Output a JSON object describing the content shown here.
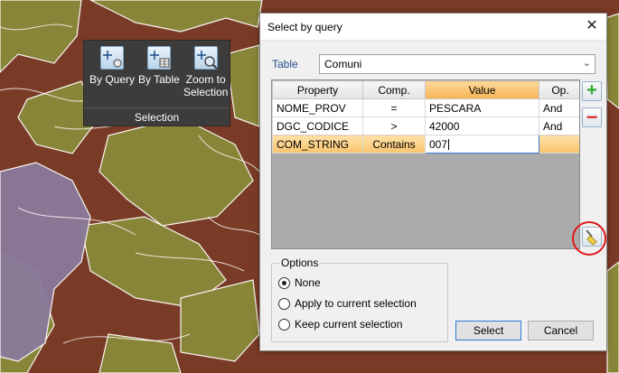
{
  "ribbon": {
    "buttons": [
      {
        "label": "By Query",
        "icon": "select-query-icon"
      },
      {
        "label": "By Table",
        "icon": "select-table-icon"
      },
      {
        "label_line1": "Zoom to",
        "label_line2": "Selection",
        "icon": "zoom-selection-icon"
      }
    ],
    "group_label": "Selection"
  },
  "dialog": {
    "title": "Select by query",
    "close_glyph": "✕",
    "table_label": "Table",
    "table_value": "Comuni",
    "columns": [
      "Property",
      "Comp.",
      "Value",
      "Op."
    ],
    "rows": [
      {
        "property": "NOME_PROV",
        "comp": "=",
        "value": "PESCARA",
        "op": "And"
      },
      {
        "property": "DGC_CODICE",
        "comp": ">",
        "value": "42000",
        "op": "And"
      },
      {
        "property": "COM_STRING",
        "comp": "Contains",
        "value": "007",
        "op": ""
      }
    ],
    "add_glyph": "+",
    "remove_glyph": "−",
    "options": {
      "legend": "Options",
      "choices": [
        "None",
        "Apply to current selection",
        "Keep current selection"
      ],
      "selected": "None"
    },
    "select_label": "Select",
    "cancel_label": "Cancel"
  },
  "colors": {
    "map_brown": "#7a3b26",
    "map_olive": "#8a8a3a",
    "map_purple": "#8a7a9a",
    "ribbon_bg": "#3c3c3c",
    "highlight_orange": "#f5b455",
    "annotation_red": "#e01818"
  }
}
